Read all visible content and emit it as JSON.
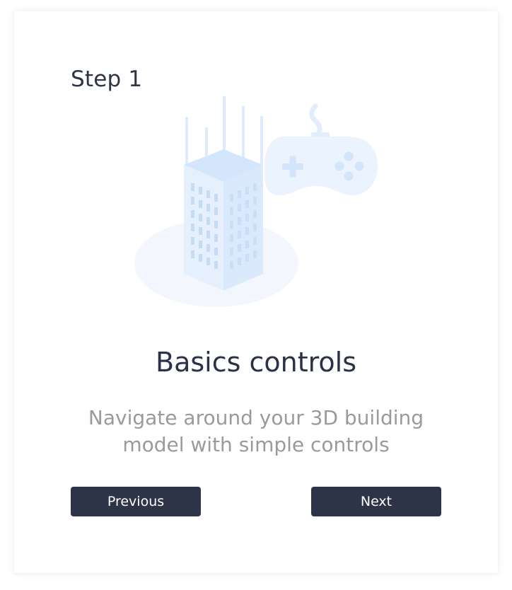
{
  "onboarding": {
    "step_label": "Step 1",
    "title": "Basics controls",
    "description": "Navigate around your 3D building model with simple controls",
    "previous_label": "Previous",
    "next_label": "Next"
  },
  "illustration": {
    "icons": [
      "building-icon",
      "gamepad-icon"
    ],
    "colors": {
      "light_blue": "#e8f1fd",
      "mid_blue": "#d3e4fb",
      "window_blue": "#b9d3f5",
      "button_dark": "#2e3448"
    }
  }
}
